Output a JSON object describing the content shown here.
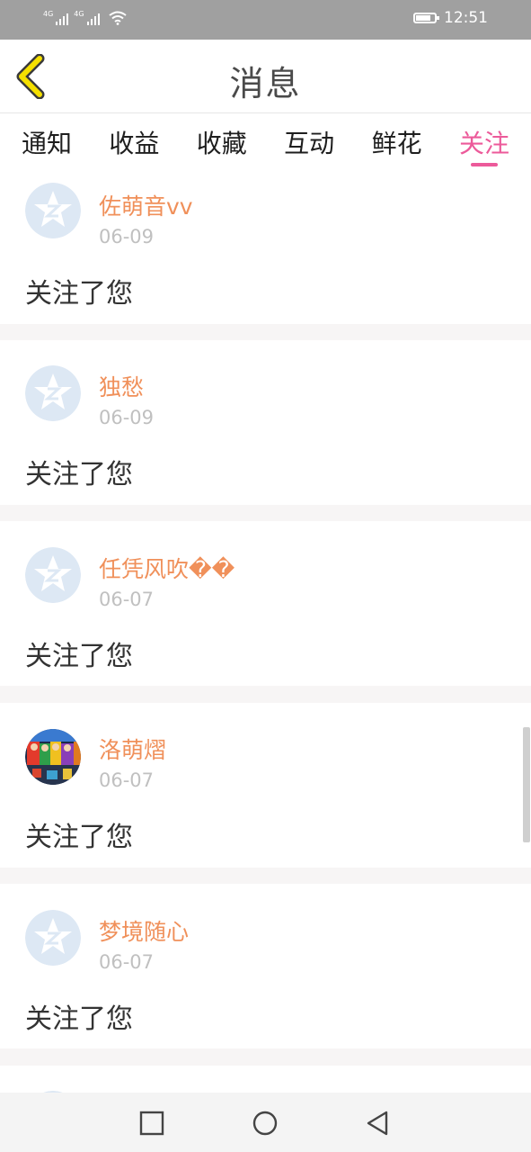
{
  "status_bar": {
    "time": "12:51",
    "signal_labels": [
      "4G",
      "4G"
    ],
    "battery_level": 0.9
  },
  "header": {
    "title": "消息"
  },
  "tabs": [
    {
      "label": "通知",
      "active": false
    },
    {
      "label": "收益",
      "active": false
    },
    {
      "label": "收藏",
      "active": false
    },
    {
      "label": "互动",
      "active": false
    },
    {
      "label": "鲜花",
      "active": false
    },
    {
      "label": "关注",
      "active": true
    }
  ],
  "messages": [
    {
      "name": "佐萌音vv",
      "date": "06-09",
      "text": "关注了您",
      "avatar": "default-avatar"
    },
    {
      "name": "独愁",
      "date": "06-09",
      "text": "关注了您",
      "avatar": "default-avatar"
    },
    {
      "name": "任凭风吹��",
      "date": "06-07",
      "text": "关注了您",
      "avatar": "default-avatar"
    },
    {
      "name": "洛萌熠",
      "date": "06-07",
      "text": "关注了您",
      "avatar": "user-photo-avatar"
    },
    {
      "name": "梦境随心",
      "date": "06-07",
      "text": "关注了您",
      "avatar": "default-avatar"
    }
  ],
  "colors": {
    "accent": "#ec5a9a",
    "username": "#f0905a",
    "date": "#c0c0c0",
    "back_arrow": "#f5e000",
    "default_avatar_bg": "#dde8f4"
  },
  "icons": {
    "back": "back-arrow-icon",
    "nav": [
      "recent-apps-icon",
      "home-icon",
      "back-triangle-icon"
    ]
  }
}
